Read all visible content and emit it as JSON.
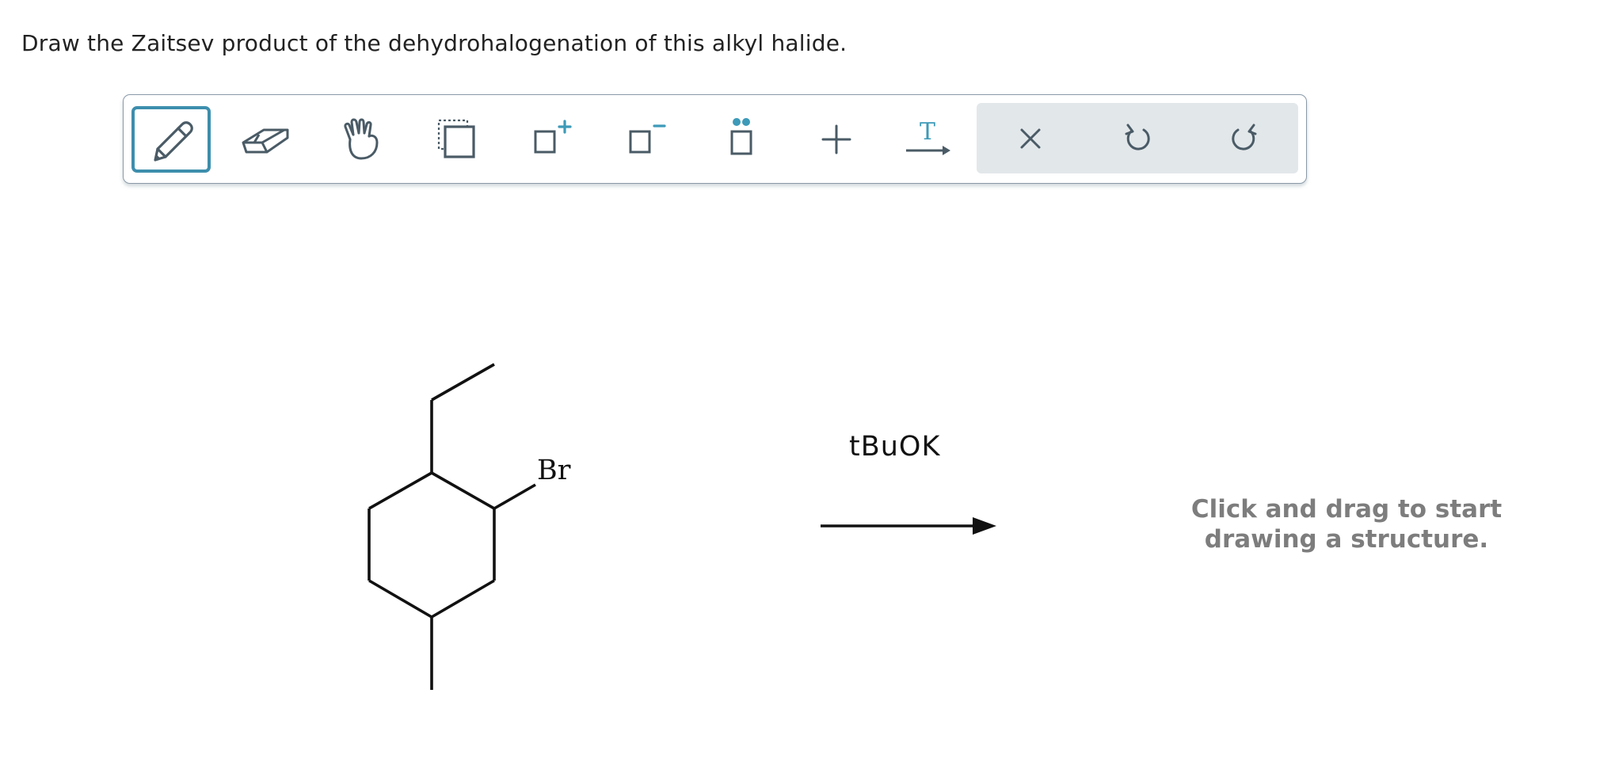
{
  "question": {
    "text": "Draw the Zaitsev product of the dehydrohalogenation of this alkyl halide."
  },
  "toolbar": {
    "tools": [
      {
        "name": "pencil-icon",
        "active": true
      },
      {
        "name": "eraser-icon",
        "active": false
      },
      {
        "name": "hand-icon",
        "active": false
      },
      {
        "name": "select-icon",
        "active": false
      },
      {
        "name": "charge-plus-icon",
        "active": false
      },
      {
        "name": "charge-minus-icon",
        "active": false
      },
      {
        "name": "lone-pair-icon",
        "active": false
      },
      {
        "name": "plus-icon",
        "active": false
      },
      {
        "name": "text-arrow-icon",
        "active": false
      }
    ],
    "actions": [
      "close-icon",
      "undo-icon",
      "redo-icon"
    ],
    "accent_color": "#3d8ead",
    "icon_color": "#4a5b66"
  },
  "reaction": {
    "substituent_label": "Br",
    "reagent": "tBuOK"
  },
  "drawing_area": {
    "hint_line1": "Click and drag to start",
    "hint_line2": "drawing a structure."
  }
}
